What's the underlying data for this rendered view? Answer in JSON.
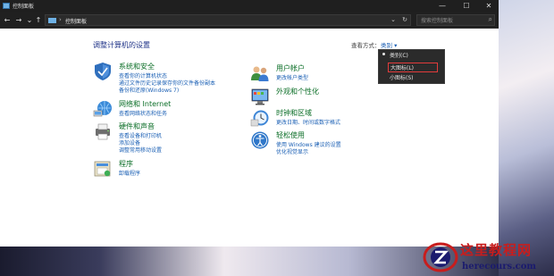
{
  "window": {
    "title": "控制面板"
  },
  "controls": {
    "minimize": "—",
    "maximize": "☐",
    "close": "✕"
  },
  "nav": {
    "back": "←",
    "forward": "→",
    "recent": "⌄",
    "up": "↑"
  },
  "address": {
    "separator": "›",
    "crumb": "控制面板",
    "dropdown": "⌄",
    "refresh": "↻"
  },
  "search": {
    "placeholder": "搜索控制面板",
    "icon": "search-icon"
  },
  "content": {
    "title": "调整计算机的设置",
    "view_by_label": "查看方式：",
    "view_by_value": "类别 ▾"
  },
  "categories": [
    {
      "name": "系统和安全",
      "icon": "shield-icon",
      "links": [
        "查看你的计算机状态",
        "通过文件历史记录保存你的文件备份副本",
        "备份和还原(Windows 7)"
      ]
    },
    {
      "name": "网络和 Internet",
      "icon": "network-icon",
      "links": [
        "查看网络状态和任务"
      ]
    },
    {
      "name": "硬件和声音",
      "icon": "printer-icon",
      "links": [
        "查看设备和打印机",
        "添加设备",
        "调整常用移动设置"
      ]
    },
    {
      "name": "程序",
      "icon": "programs-icon",
      "links": [
        "卸载程序"
      ]
    },
    {
      "name": "用户帐户",
      "icon": "users-icon",
      "links": [
        "更改帐户类型"
      ]
    },
    {
      "name": "外观和个性化",
      "icon": "appearance-icon",
      "links": []
    },
    {
      "name": "时钟和区域",
      "icon": "clock-icon",
      "links": [
        "更改日期、时间或数字格式"
      ]
    },
    {
      "name": "轻松使用",
      "icon": "ease-of-access-icon",
      "links": [
        "使用 Windows 建议的设置",
        "优化视觉显示"
      ]
    }
  ],
  "view_menu": {
    "items": [
      "类别(C)",
      "大图标(L)",
      "小图标(S)"
    ],
    "selected": "类别(C)",
    "highlighted": "大图标(L)"
  },
  "watermark": {
    "title": "这里教程网",
    "url": "herecours.com"
  },
  "colors": {
    "link": "#1a5fb4",
    "category_head": "#0b6e27",
    "title": "#1e3287",
    "highlight_border": "#e23b3b"
  }
}
